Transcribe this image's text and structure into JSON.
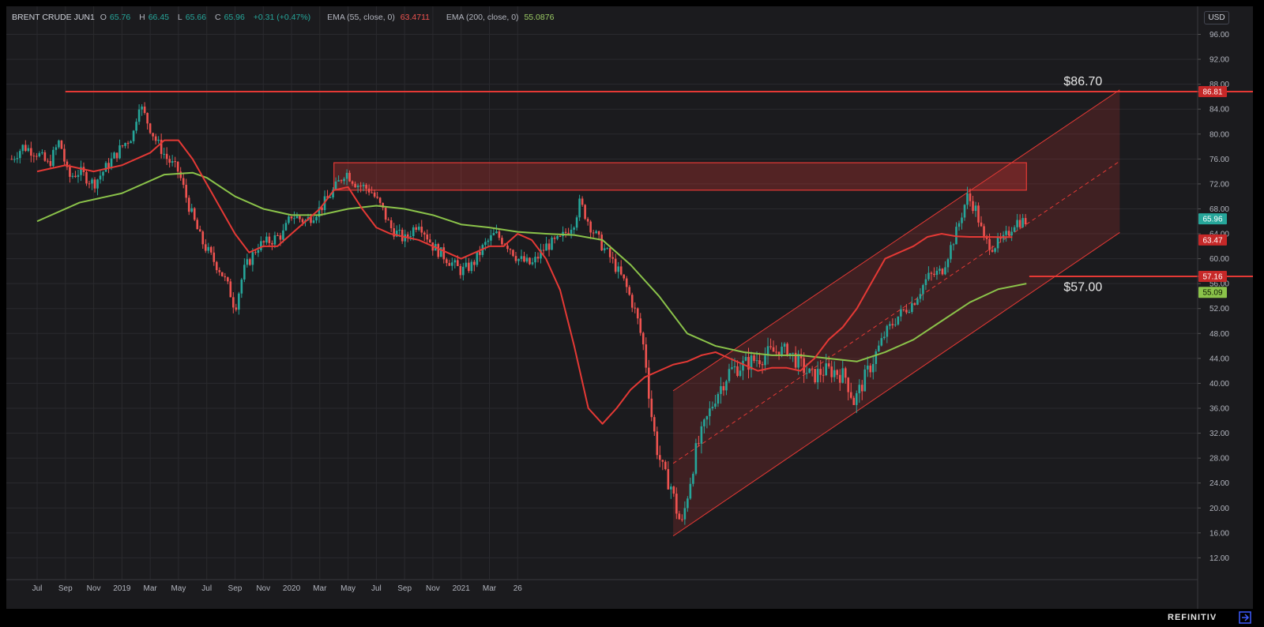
{
  "legend": {
    "symbol": "BRENT CRUDE JUN1",
    "o_label": "O",
    "o_value": "65.76",
    "h_label": "H",
    "h_value": "66.45",
    "l_label": "L",
    "l_value": "65.66",
    "c_label": "C",
    "c_value": "65.96",
    "change": "+0.31 (+0.47%)",
    "ema55_label": "EMA (55, close, 0)",
    "ema55_value": "63.4711",
    "ema200_label": "EMA (200, close, 0)",
    "ema200_value": "55.0876"
  },
  "currency": "USD",
  "brand": "REFINITIV",
  "colors": {
    "background": "#1b1b1e",
    "up": "#26a69a",
    "down": "#ef5350",
    "ema55": "#e53935",
    "ema200": "#8bc34a",
    "annotation": "#e53935"
  },
  "chart_data": {
    "type": "candlestick",
    "x_ticks": [
      "Jul",
      "Sep",
      "Nov",
      "2019",
      "Mar",
      "May",
      "Jul",
      "Sep",
      "Nov",
      "2020",
      "Mar",
      "May",
      "Jul",
      "Sep",
      "Nov",
      "2021",
      "Mar",
      "26"
    ],
    "y_ticks": [
      "96.00",
      "92.00",
      "88.00",
      "84.00",
      "80.00",
      "76.00",
      "72.00",
      "68.00",
      "64.00",
      "60.00",
      "56.00",
      "52.00",
      "48.00",
      "44.00",
      "40.00",
      "36.00",
      "32.00",
      "28.00",
      "24.00",
      "20.00",
      "16.00",
      "12.00"
    ],
    "ylim": [
      8.5,
      100.5
    ],
    "price_labels": [
      {
        "text": "86.81",
        "value": 86.81,
        "color": "#c62828"
      },
      {
        "text": "65.96",
        "value": 66.4,
        "color": "#26a69a"
      },
      {
        "text": "63.47",
        "value": 63.0,
        "color": "#c62828"
      },
      {
        "text": "57.16",
        "value": 57.16,
        "color": "#c62828"
      },
      {
        "text": "55.09",
        "value": 54.6,
        "color": "#8bc34a"
      }
    ],
    "annotations": [
      {
        "text": "$86.70",
        "level": 86.7
      },
      {
        "text": "$57.00",
        "level": 57.0
      }
    ],
    "horizontal_lines": [
      {
        "level": 86.81,
        "from_x": 1.0,
        "to_x": 43.3
      },
      {
        "level": 57.16,
        "from_x": 35.1,
        "to_x": 43.3
      }
    ],
    "resistance_zone": {
      "x_start": 10.5,
      "x_end": 35.0,
      "high": 75.4,
      "low": 71.0
    },
    "channel": {
      "x_start": 22.5,
      "x_end": 38.3,
      "upper_start": 38.8,
      "upper_end": 87.1,
      "lower_start": 15.5,
      "lower_end": 64.2
    },
    "ema200": {
      "x": [
        0,
        1.5,
        3,
        4.5,
        5.5,
        6,
        7,
        8,
        9,
        10,
        11,
        12,
        13,
        14,
        15,
        16,
        17,
        18,
        19,
        20,
        21,
        22,
        23,
        24,
        25,
        26,
        27,
        28,
        29,
        30,
        31,
        32,
        33,
        34,
        35
      ],
      "y": [
        66,
        69,
        70.5,
        73.5,
        73.8,
        73,
        70,
        68,
        67,
        67,
        68,
        68.5,
        68,
        67,
        65.5,
        65,
        64.3,
        64,
        63.8,
        63,
        59,
        54,
        48,
        46,
        45,
        44.5,
        44.5,
        44,
        43.5,
        45,
        47,
        50,
        53,
        55.1,
        56
      ]
    },
    "ema55": {
      "x": [
        0,
        1,
        2,
        3,
        4,
        4.5,
        5,
        5.5,
        6,
        6.5,
        7,
        7.5,
        8,
        8.5,
        9,
        9.5,
        10,
        10.5,
        11,
        11.5,
        12,
        12.5,
        13,
        13.5,
        14,
        14.5,
        15,
        15.5,
        16,
        16.5,
        17,
        17.5,
        18,
        18.5,
        19,
        19.5,
        20,
        20.5,
        21,
        21.5,
        22,
        22.5,
        23,
        23.5,
        24,
        24.5,
        25,
        25.5,
        26,
        26.5,
        27,
        27.5,
        28,
        28.5,
        29,
        29.5,
        30,
        30.5,
        31,
        31.5,
        32,
        32.5,
        33,
        33.5,
        34,
        34.5,
        35
      ],
      "y": [
        74,
        75,
        74,
        75,
        77,
        79,
        79,
        76,
        72,
        68,
        64,
        61,
        62,
        62,
        64,
        66,
        68,
        71,
        71.5,
        68,
        65,
        64,
        63.5,
        63,
        62,
        61,
        60,
        61,
        62,
        62,
        64,
        63,
        60,
        55,
        46,
        36,
        33.5,
        36,
        39,
        41,
        42,
        43,
        43.5,
        44.5,
        45,
        44,
        43,
        42,
        42.5,
        42.5,
        42,
        44,
        47,
        49,
        52,
        56,
        60,
        61,
        62,
        63.5,
        64,
        63.6,
        63.5,
        63.5,
        63.47,
        63.47
      ]
    }
  }
}
